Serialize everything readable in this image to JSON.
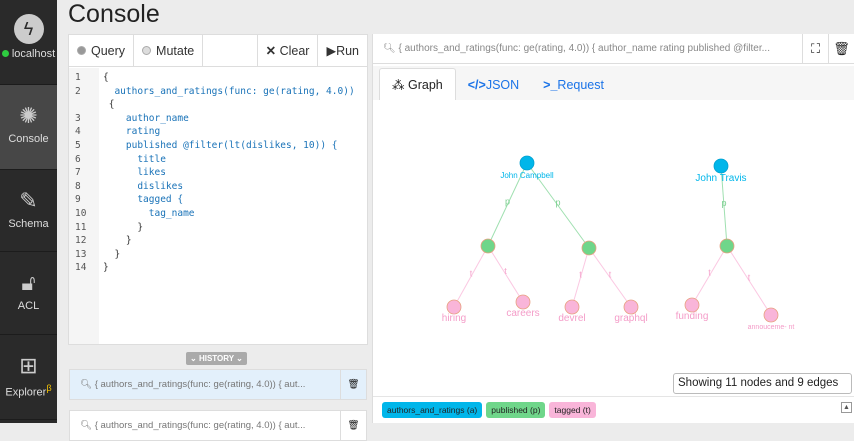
{
  "sidebar": {
    "server": "localhost",
    "items": [
      {
        "label": "Console"
      },
      {
        "label": "Schema"
      },
      {
        "label": "ACL"
      },
      {
        "label": "Explorer",
        "badge": "β"
      }
    ]
  },
  "page_title": "Console",
  "editor": {
    "query_label": "Query",
    "mutate_label": "Mutate",
    "clear_label": "Clear",
    "run_label": "Run",
    "lines": [
      {
        "n": "1",
        "t": "{"
      },
      {
        "n": "2",
        "t": "  authors_and_ratings(func: ge(rating, 4.0))"
      },
      {
        "n": "",
        "t": " {"
      },
      {
        "n": "3",
        "t": "    author_name"
      },
      {
        "n": "4",
        "t": "    rating"
      },
      {
        "n": "5",
        "t": "    published @filter(lt(dislikes, 10)) {"
      },
      {
        "n": "6",
        "t": "      title"
      },
      {
        "n": "7",
        "t": "      likes"
      },
      {
        "n": "8",
        "t": "      dislikes"
      },
      {
        "n": "9",
        "t": "      tagged {"
      },
      {
        "n": "10",
        "t": "        tag_name"
      },
      {
        "n": "11",
        "t": "      }"
      },
      {
        "n": "12",
        "t": "    }"
      },
      {
        "n": "13",
        "t": "  }"
      },
      {
        "n": "14",
        "t": "}"
      }
    ]
  },
  "history": {
    "label": "HISTORY",
    "items": [
      {
        "query": "{ authors_and_ratings(func: ge(rating, 4.0)) { aut..."
      },
      {
        "query": "{ authors_and_ratings(func: ge(rating, 4.0)) { aut..."
      }
    ]
  },
  "result": {
    "query": "{ authors_and_ratings(func: ge(rating, 4.0)) { author_name rating published @filter...",
    "tabs": [
      {
        "label": "Graph"
      },
      {
        "label": "JSON"
      },
      {
        "label": "Request"
      }
    ],
    "status": "Showing 11 nodes and 9 edges",
    "legend": [
      {
        "label": "authors_and_ratings (a)",
        "color": "#00b6ea"
      },
      {
        "label": "published (p)",
        "color": "#6fd68a"
      },
      {
        "label": "tagged (t)",
        "color": "#f9b5d9"
      }
    ],
    "nodes": {
      "a1": "John Campbell",
      "a2": "John Travis",
      "t1": "hiring",
      "t2": "careers",
      "t3": "devrel",
      "t4": "graphql",
      "t5": "funding",
      "t6": "annouceme- nt"
    },
    "edge_labels": {
      "p": "p",
      "t": "t"
    }
  }
}
